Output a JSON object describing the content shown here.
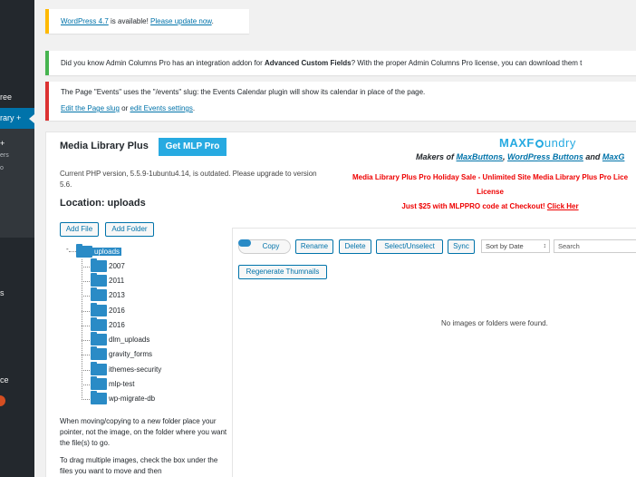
{
  "sidebar": {
    "items": [
      {
        "label": "ree"
      },
      {
        "label": "rary +"
      },
      {
        "label": "s"
      },
      {
        "label": "ce"
      }
    ],
    "subitems": [
      {
        "label": "+"
      },
      {
        "label": "ers"
      },
      {
        "label": "o"
      }
    ]
  },
  "notices": {
    "update": {
      "prefix": "WordPress 4.7",
      "middle": " is available! ",
      "link": "Please update now",
      "suffix": "."
    },
    "info": {
      "pre": "Did you know Admin Columns Pro has an integration addon for ",
      "strong": "Advanced Custom Fields",
      "post": "? With the proper Admin Columns Pro license, you can download them t"
    },
    "error": {
      "line1": "The Page \"Events\" uses the \"/events\" slug: the Events Calendar plugin will show its calendar in place of the page.",
      "link1": "Edit the Page slug",
      "mid": " or ",
      "link2": "edit Events settings",
      "end": "."
    }
  },
  "panel": {
    "title": "Media Library Plus",
    "get_pro": "Get MLP Pro",
    "logo_max": "MAXF",
    "logo_rest": "undry",
    "makers_pre": "Makers of ",
    "makers_link1": "MaxButtons",
    "makers_sep": ", ",
    "makers_link2": "WordPress Buttons",
    "makers_and": " and ",
    "makers_link3": "MaxG",
    "php_notice": "Current PHP version, 5.5.9-1ubuntu4.14, is outdated. Please upgrade to version 5.6.",
    "promo_line1": "Media Library Plus Pro Holiday Sale - Unlimited Site Media Library Plus Pro Lice",
    "promo_line2": "License",
    "promo_line3_pre": "Just $25 with MLPPRO code at Checkout! ",
    "promo_link": "Click Her",
    "location": "Location: uploads"
  },
  "buttons": {
    "add_file": "Add File",
    "add_folder": "Add Folder",
    "copy": "Copy",
    "rename": "Rename",
    "delete": "Delete",
    "select_unselect": "Select/Unselect",
    "sync": "Sync",
    "regenerate": "Regenerate Thumnails"
  },
  "sort": {
    "selected": "Sort by Date"
  },
  "search": {
    "placeholder": "Search"
  },
  "tree": {
    "root": "uploads",
    "folders": [
      "2007",
      "2011",
      "2013",
      "2016",
      "2016",
      "dlm_uploads",
      "gravity_forms",
      "ithemes-security",
      "mlp-test",
      "wp-migrate-db"
    ]
  },
  "help": {
    "p1": "When moving/copying to a new folder place your pointer, not the image, on the folder where you want the file(s) to go.",
    "p2": "To drag multiple images, check the box under the files you want to move and then"
  },
  "empty_message": "No images or folders were found.",
  "colors": {
    "accent": "#0073aa",
    "folder": "#2a8bc6",
    "promo": "#ee0000",
    "logo": "#27aae1"
  }
}
